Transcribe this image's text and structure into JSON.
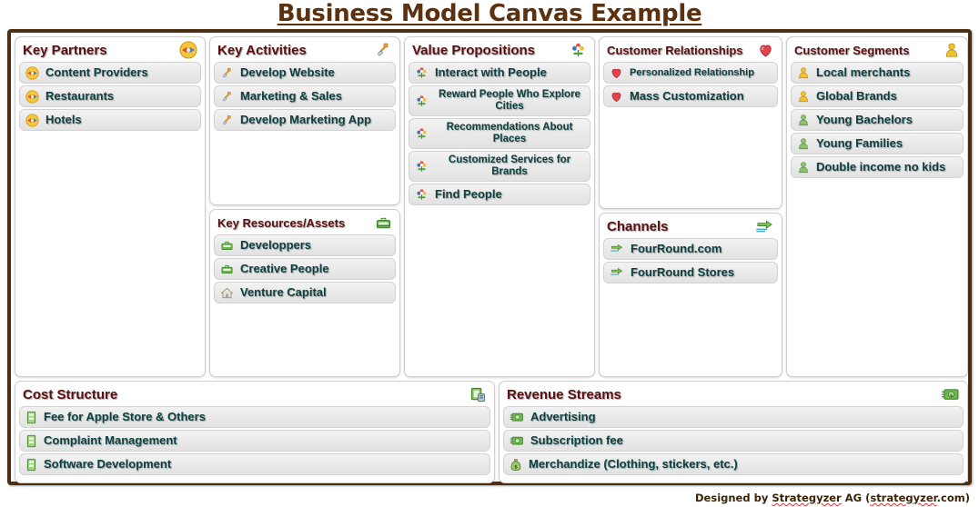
{
  "title": "Business Model Canvas Example",
  "footer": {
    "prefix": "Designed by ",
    "word1": "Strategyzer",
    "middle": " AG (",
    "word2": "strategyzer",
    "suffix": ".com)"
  },
  "colors": {
    "frame": "#4d2e10",
    "title": "#5b3110",
    "panel_heading": "#5a1010",
    "item_text": "#0d4040",
    "item_bg": "#eaeaea"
  },
  "panels": {
    "key_partners": {
      "title": "Key Partners",
      "icon": "handshake-icon",
      "items": [
        {
          "label": "Content Providers",
          "icon": "handshake-icon"
        },
        {
          "label": "Restaurants",
          "icon": "handshake-icon"
        },
        {
          "label": "Hotels",
          "icon": "handshake-icon"
        }
      ]
    },
    "key_activities": {
      "title": "Key Activities",
      "icon": "shovel-icon",
      "items": [
        {
          "label": "Develop Website",
          "icon": "shovel-icon"
        },
        {
          "label": "Marketing & Sales",
          "icon": "shovel-icon"
        },
        {
          "label": "Develop Marketing App",
          "icon": "shovel-icon"
        }
      ]
    },
    "key_resources": {
      "title": "Key Resources/Assets",
      "icon": "briefcase-icon",
      "items": [
        {
          "label": "Developpers",
          "icon": "briefcase-icon"
        },
        {
          "label": "Creative People",
          "icon": "briefcase-icon"
        },
        {
          "label": "Venture Capital",
          "icon": "house-icon"
        }
      ]
    },
    "value_propositions": {
      "title": "Value Propositions",
      "icon": "flower-icon",
      "items": [
        {
          "label": "Interact with People",
          "icon": "flower-icon",
          "size": "normal"
        },
        {
          "label": "Reward People Who Explore Cities",
          "icon": "flower-icon",
          "size": "small"
        },
        {
          "label": "Recommendations About Places",
          "icon": "flower-icon",
          "size": "small"
        },
        {
          "label": "Customized Services for Brands",
          "icon": "flower-icon",
          "size": "small"
        },
        {
          "label": "Find People",
          "icon": "flower-icon",
          "size": "normal"
        }
      ]
    },
    "customer_relationships": {
      "title": "Customer Relationships",
      "icon": "heart-icon",
      "items": [
        {
          "label": "Personalized Relationship",
          "icon": "heart-icon",
          "size": "small"
        },
        {
          "label": "Mass Customization",
          "icon": "heart-icon",
          "size": "normal"
        }
      ]
    },
    "channels": {
      "title": "Channels",
      "icon": "arrows-icon",
      "items": [
        {
          "label": "FourRound.com",
          "icon": "arrows-icon"
        },
        {
          "label": "FourRound Stores",
          "icon": "arrows-icon"
        }
      ]
    },
    "customer_segments": {
      "title": "Customer Segments",
      "icon": "person-yellow-icon",
      "items": [
        {
          "label": "Local merchants",
          "icon": "person-yellow-icon"
        },
        {
          "label": "Global Brands",
          "icon": "person-yellow-icon"
        },
        {
          "label": "Young Bachelors",
          "icon": "person-green-icon"
        },
        {
          "label": "Young Families",
          "icon": "person-green-icon"
        },
        {
          "label": "Double income no kids",
          "icon": "person-green-icon"
        }
      ]
    },
    "cost_structure": {
      "title": "Cost Structure",
      "icon": "copy-documents-icon",
      "items": [
        {
          "label": "Fee for Apple Store & Others",
          "icon": "document-icon"
        },
        {
          "label": "Complaint Management",
          "icon": "document-icon"
        },
        {
          "label": "Software Development",
          "icon": "document-icon"
        }
      ]
    },
    "revenue_streams": {
      "title": "Revenue Streams",
      "icon": "banknote-icon",
      "items": [
        {
          "label": "Advertising",
          "icon": "banknote-icon"
        },
        {
          "label": "Subscription fee",
          "icon": "banknote-icon"
        },
        {
          "label": "Merchandize (Clothing, stickers, etc.)",
          "icon": "moneybag-icon"
        }
      ]
    }
  }
}
